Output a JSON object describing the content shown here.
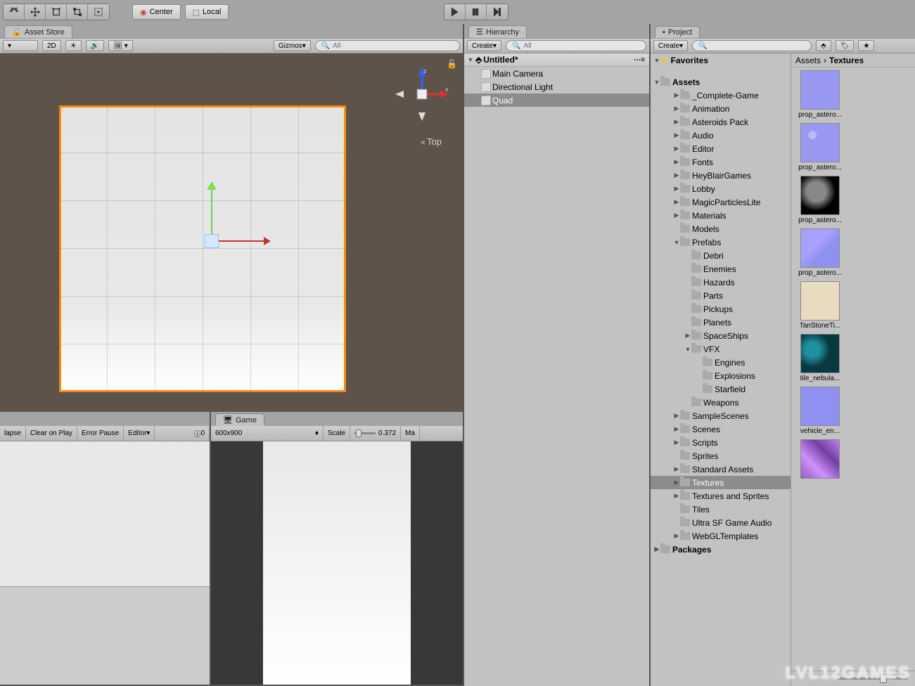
{
  "toolbar": {
    "center_label": "Center",
    "local_label": "Local"
  },
  "scene": {
    "tab_label": "Asset Store",
    "btn_2d": "2D",
    "gizmos_label": "Gizmos",
    "search_placeholder": "All",
    "view_label": "Top",
    "axis_x": "x",
    "axis_z": "z"
  },
  "console": {
    "clear": "lapse",
    "clear_on_play": "Clear on Play",
    "error_pause": "Error Pause",
    "editor": "Editor",
    "count0": "0"
  },
  "game": {
    "tab_label": "Game",
    "aspect": "600x900",
    "scale_label": "Scale",
    "scale_value": "0.372",
    "max_label": "Ma"
  },
  "hierarchy": {
    "tab_label": "Hierarchy",
    "create_label": "Create",
    "search_placeholder": "All",
    "scene_name": "Untitled*",
    "items": [
      {
        "name": "Main Camera",
        "sel": false
      },
      {
        "name": "Directional Light",
        "sel": false
      },
      {
        "name": "Quad",
        "sel": true
      }
    ]
  },
  "project": {
    "tab_label": "Project",
    "create_label": "Create",
    "favorites_label": "Favorites",
    "assets_label": "Assets",
    "packages_label": "Packages",
    "breadcrumb_root": "Assets",
    "breadcrumb_current": "Textures",
    "tree": [
      {
        "d": 2,
        "n": "_Complete-Game",
        "a": true
      },
      {
        "d": 2,
        "n": "Animation",
        "a": true
      },
      {
        "d": 2,
        "n": "Asteroids Pack",
        "a": true
      },
      {
        "d": 2,
        "n": "Audio",
        "a": true
      },
      {
        "d": 2,
        "n": "Editor",
        "a": true
      },
      {
        "d": 2,
        "n": "Fonts",
        "a": true
      },
      {
        "d": 2,
        "n": "HeyBlairGames",
        "a": true
      },
      {
        "d": 2,
        "n": "Lobby",
        "a": true
      },
      {
        "d": 2,
        "n": "MagicParticlesLite",
        "a": true
      },
      {
        "d": 2,
        "n": "Materials",
        "a": true
      },
      {
        "d": 2,
        "n": "Models",
        "a": false
      },
      {
        "d": 2,
        "n": "Prefabs",
        "a": true,
        "open": true
      },
      {
        "d": 3,
        "n": "Debri",
        "a": false
      },
      {
        "d": 3,
        "n": "Enemies",
        "a": false
      },
      {
        "d": 3,
        "n": "Hazards",
        "a": false
      },
      {
        "d": 3,
        "n": "Parts",
        "a": false
      },
      {
        "d": 3,
        "n": "Pickups",
        "a": false
      },
      {
        "d": 3,
        "n": "Planets",
        "a": false
      },
      {
        "d": 3,
        "n": "SpaceShips",
        "a": true
      },
      {
        "d": 3,
        "n": "VFX",
        "a": true,
        "open": true
      },
      {
        "d": 4,
        "n": "Engines",
        "a": false
      },
      {
        "d": 4,
        "n": "Explosions",
        "a": false
      },
      {
        "d": 4,
        "n": "Starfield",
        "a": false
      },
      {
        "d": 3,
        "n": "Weapons",
        "a": false
      },
      {
        "d": 2,
        "n": "SampleScenes",
        "a": true
      },
      {
        "d": 2,
        "n": "Scenes",
        "a": true
      },
      {
        "d": 2,
        "n": "Scripts",
        "a": true
      },
      {
        "d": 2,
        "n": "Sprites",
        "a": false
      },
      {
        "d": 2,
        "n": "Standard Assets",
        "a": true
      },
      {
        "d": 2,
        "n": "Textures",
        "a": true,
        "sel": true
      },
      {
        "d": 2,
        "n": "Textures and Sprites",
        "a": true
      },
      {
        "d": 2,
        "n": "Tiles",
        "a": false
      },
      {
        "d": 2,
        "n": "Ultra SF Game Audio",
        "a": false
      },
      {
        "d": 2,
        "n": "WebGLTemplates",
        "a": true
      }
    ],
    "assets": [
      {
        "n": "prop_astero...",
        "c": "#9898f0"
      },
      {
        "n": "prop_astero...",
        "c": "#a098e8",
        "img": "craters"
      },
      {
        "n": "prop_astero...",
        "c": "#101010",
        "img": "rock"
      },
      {
        "n": "prop_astero...",
        "c": "#9898f0",
        "img": "normal2"
      },
      {
        "n": "TanStoneTi...",
        "c": "#e8dcc0"
      },
      {
        "n": "tile_nebula...",
        "c": "#083840",
        "img": "nebula"
      },
      {
        "n": "vehicle_en...",
        "c": "#9090f0"
      },
      {
        "n": "",
        "c": "#9060c0",
        "img": "crystal"
      }
    ]
  },
  "watermark": "LVL12GAMES"
}
